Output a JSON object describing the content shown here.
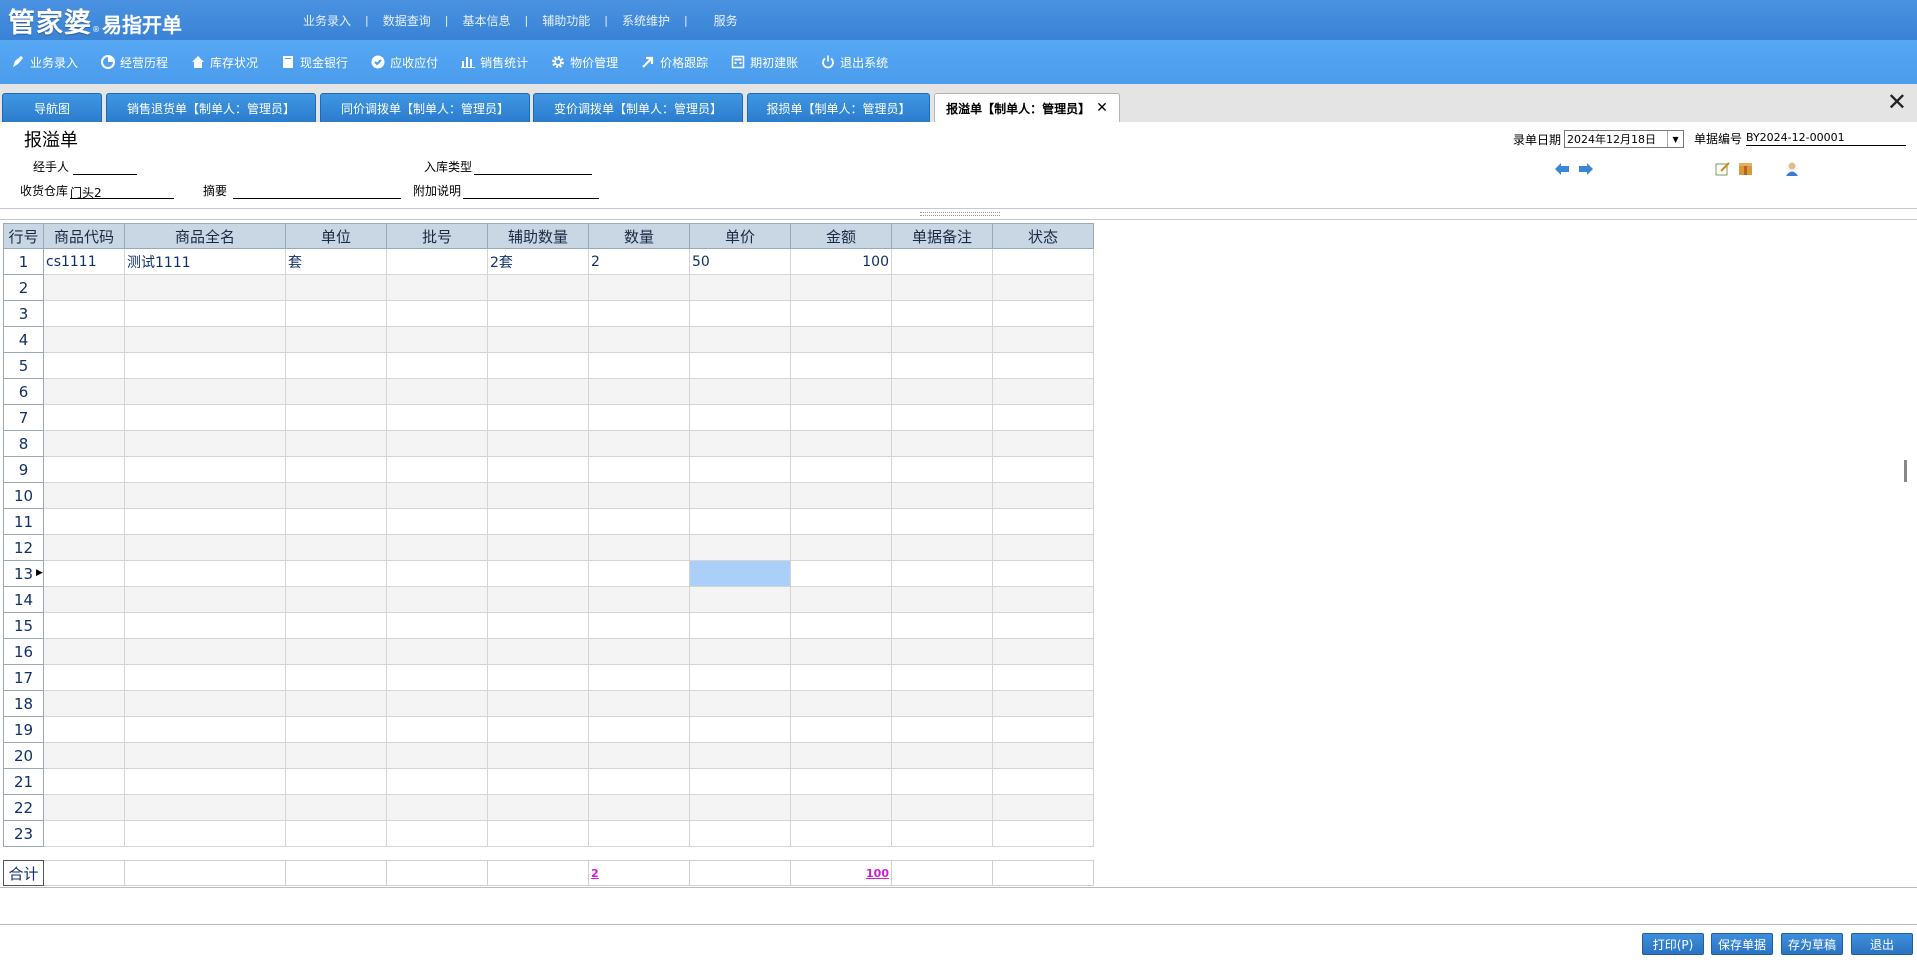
{
  "brand": {
    "main": "管家婆",
    "reg": "®",
    "sub": "易指开单"
  },
  "top_menu": [
    "业务录入",
    "数据查询",
    "基本信息",
    "辅助功能",
    "系统维护",
    "服务"
  ],
  "toolbar": [
    {
      "label": "业务录入",
      "icon": "pen-icon"
    },
    {
      "label": "经营历程",
      "icon": "pie-chart-icon"
    },
    {
      "label": "库存状况",
      "icon": "home-icon"
    },
    {
      "label": "现金银行",
      "icon": "book-icon"
    },
    {
      "label": "应收应付",
      "icon": "check-circle-icon"
    },
    {
      "label": "销售统计",
      "icon": "bar-chart-icon"
    },
    {
      "label": "物价管理",
      "icon": "gear-icon"
    },
    {
      "label": "价格跟踪",
      "icon": "arrow-icon"
    },
    {
      "label": "期初建账",
      "icon": "calculator-icon"
    },
    {
      "label": "退出系统",
      "icon": "power-icon"
    }
  ],
  "tabs": [
    {
      "label": "导航图"
    },
    {
      "label": "销售退货单【制单人：管理员】"
    },
    {
      "label": "同价调拨单【制单人：管理员】"
    },
    {
      "label": "变价调拨单【制单人：管理员】"
    },
    {
      "label": "报损单【制单人：管理员】"
    },
    {
      "label": "报溢单【制单人：管理员】"
    }
  ],
  "form": {
    "title": "报溢单",
    "handler_label": "经手人",
    "handler_value": "",
    "instock_type_label": "入库类型",
    "instock_type_value": "",
    "warehouse_label": "收货仓库",
    "warehouse_value": "门头2",
    "summary_label": "摘要",
    "summary_value": "",
    "extra_label": "附加说明",
    "extra_value": "",
    "date_label": "录单日期",
    "date_value": "2024年12月18日",
    "doc_no_label": "单据编号",
    "doc_no_value": "BY2024-12-00001"
  },
  "grid": {
    "columns": [
      "行号",
      "商品代码",
      "商品全名",
      "单位",
      "批号",
      "辅助数量",
      "数量",
      "单价",
      "金额",
      "单据备注",
      "状态"
    ],
    "rows": [
      [
        "1",
        "cs1111",
        "测试1111",
        "套",
        "",
        "2套",
        "2",
        "50",
        "100",
        "",
        ""
      ],
      [
        "2",
        "",
        "",
        "",
        "",
        "",
        "",
        "",
        "",
        "",
        ""
      ],
      [
        "3",
        "",
        "",
        "",
        "",
        "",
        "",
        "",
        "",
        "",
        ""
      ],
      [
        "4",
        "",
        "",
        "",
        "",
        "",
        "",
        "",
        "",
        "",
        ""
      ],
      [
        "5",
        "",
        "",
        "",
        "",
        "",
        "",
        "",
        "",
        "",
        ""
      ],
      [
        "6",
        "",
        "",
        "",
        "",
        "",
        "",
        "",
        "",
        "",
        ""
      ],
      [
        "7",
        "",
        "",
        "",
        "",
        "",
        "",
        "",
        "",
        "",
        ""
      ],
      [
        "8",
        "",
        "",
        "",
        "",
        "",
        "",
        "",
        "",
        "",
        ""
      ],
      [
        "9",
        "",
        "",
        "",
        "",
        "",
        "",
        "",
        "",
        "",
        ""
      ],
      [
        "10",
        "",
        "",
        "",
        "",
        "",
        "",
        "",
        "",
        "",
        ""
      ],
      [
        "11",
        "",
        "",
        "",
        "",
        "",
        "",
        "",
        "",
        "",
        ""
      ],
      [
        "12",
        "",
        "",
        "",
        "",
        "",
        "",
        "",
        "",
        "",
        ""
      ],
      [
        "13",
        "",
        "",
        "",
        "",
        "",
        "",
        "",
        "",
        "",
        ""
      ],
      [
        "14",
        "",
        "",
        "",
        "",
        "",
        "",
        "",
        "",
        "",
        ""
      ],
      [
        "15",
        "",
        "",
        "",
        "",
        "",
        "",
        "",
        "",
        "",
        ""
      ],
      [
        "16",
        "",
        "",
        "",
        "",
        "",
        "",
        "",
        "",
        "",
        ""
      ],
      [
        "17",
        "",
        "",
        "",
        "",
        "",
        "",
        "",
        "",
        "",
        ""
      ],
      [
        "18",
        "",
        "",
        "",
        "",
        "",
        "",
        "",
        "",
        "",
        ""
      ],
      [
        "19",
        "",
        "",
        "",
        "",
        "",
        "",
        "",
        "",
        "",
        ""
      ],
      [
        "20",
        "",
        "",
        "",
        "",
        "",
        "",
        "",
        "",
        "",
        ""
      ],
      [
        "21",
        "",
        "",
        "",
        "",
        "",
        "",
        "",
        "",
        "",
        ""
      ],
      [
        "22",
        "",
        "",
        "",
        "",
        "",
        "",
        "",
        "",
        "",
        ""
      ],
      [
        "23",
        "",
        "",
        "",
        "",
        "",
        "",
        "",
        "",
        "",
        ""
      ]
    ],
    "selected_row": 13,
    "selected_column": "单价",
    "totals_label": "合计",
    "total_qty": "2",
    "total_amount": "100"
  },
  "footer_buttons": [
    "打印(P)",
    "保存单据",
    "存为草稿",
    "退出"
  ],
  "colors": {
    "topbar": "#3a82d6",
    "toolbar": "#4b9cec",
    "tab": "#2c7ccd",
    "selected_cell": "#aad0fa",
    "totals": "#d21bd2"
  }
}
